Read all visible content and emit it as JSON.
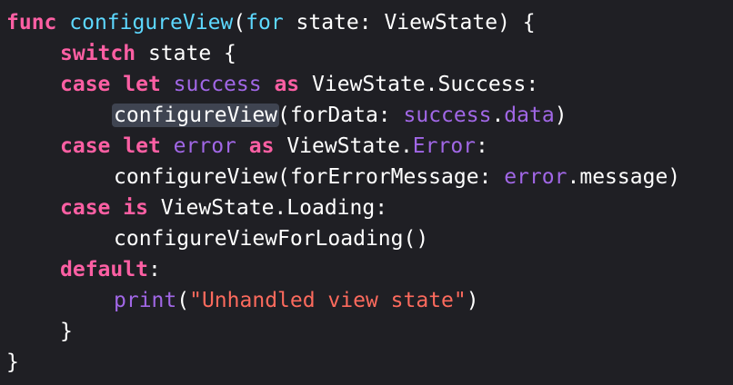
{
  "editor": {
    "lines": [
      {
        "indent": 0,
        "tokens": [
          {
            "t": "func",
            "c": "kw"
          },
          {
            "t": " ",
            "c": ""
          },
          {
            "t": "configureView",
            "c": "fn"
          },
          {
            "t": "(",
            "c": ""
          },
          {
            "t": "for",
            "c": "fn"
          },
          {
            "t": " state: ViewState) {",
            "c": ""
          }
        ]
      },
      {
        "indent": 1,
        "tokens": [
          {
            "t": "switch",
            "c": "kw"
          },
          {
            "t": " state {",
            "c": ""
          }
        ]
      },
      {
        "indent": 1,
        "tokens": [
          {
            "t": "case",
            "c": "kw"
          },
          {
            "t": " ",
            "c": ""
          },
          {
            "t": "let",
            "c": "kw"
          },
          {
            "t": " ",
            "c": ""
          },
          {
            "t": "success",
            "c": "var"
          },
          {
            "t": " ",
            "c": ""
          },
          {
            "t": "as",
            "c": "kw"
          },
          {
            "t": " ViewState.Success:",
            "c": ""
          }
        ]
      },
      {
        "indent": 2,
        "tokens": [
          {
            "t": "configureView",
            "c": "sel"
          },
          {
            "t": "(forData: ",
            "c": ""
          },
          {
            "t": "success",
            "c": "var"
          },
          {
            "t": ".",
            "c": ""
          },
          {
            "t": "data",
            "c": "var"
          },
          {
            "t": ")",
            "c": ""
          }
        ]
      },
      {
        "indent": 1,
        "tokens": [
          {
            "t": "case",
            "c": "kw"
          },
          {
            "t": " ",
            "c": ""
          },
          {
            "t": "let",
            "c": "kw"
          },
          {
            "t": " ",
            "c": ""
          },
          {
            "t": "error",
            "c": "var"
          },
          {
            "t": " ",
            "c": ""
          },
          {
            "t": "as",
            "c": "kw"
          },
          {
            "t": " ViewState.",
            "c": ""
          },
          {
            "t": "Error",
            "c": "var"
          },
          {
            "t": ":",
            "c": ""
          }
        ]
      },
      {
        "indent": 2,
        "tokens": [
          {
            "t": "configureView(forErrorMessage: ",
            "c": ""
          },
          {
            "t": "error",
            "c": "var"
          },
          {
            "t": ".message)",
            "c": ""
          }
        ]
      },
      {
        "indent": 1,
        "tokens": [
          {
            "t": "case",
            "c": "kw"
          },
          {
            "t": " ",
            "c": ""
          },
          {
            "t": "is",
            "c": "kw"
          },
          {
            "t": " ViewState.Loading:",
            "c": ""
          }
        ]
      },
      {
        "indent": 2,
        "tokens": [
          {
            "t": "configureViewForLoading()",
            "c": ""
          }
        ]
      },
      {
        "indent": 1,
        "tokens": [
          {
            "t": "default",
            "c": "kw"
          },
          {
            "t": ":",
            "c": ""
          }
        ]
      },
      {
        "indent": 2,
        "tokens": [
          {
            "t": "print",
            "c": "var"
          },
          {
            "t": "(",
            "c": ""
          },
          {
            "t": "\"Unhandled view state\"",
            "c": "str"
          },
          {
            "t": ")",
            "c": ""
          }
        ]
      },
      {
        "indent": 1,
        "tokens": [
          {
            "t": "}",
            "c": ""
          }
        ]
      },
      {
        "indent": 0,
        "tokens": [
          {
            "t": "}",
            "c": ""
          }
        ]
      }
    ]
  },
  "colors": {
    "background": "#1f1f24",
    "plain_text": "#ffffff",
    "keyword": "#fc5fa3",
    "function_name": "#5dd8ff",
    "identifier": "#a167e6",
    "string": "#fc6a5d",
    "selection_highlight": "#3f4451"
  }
}
